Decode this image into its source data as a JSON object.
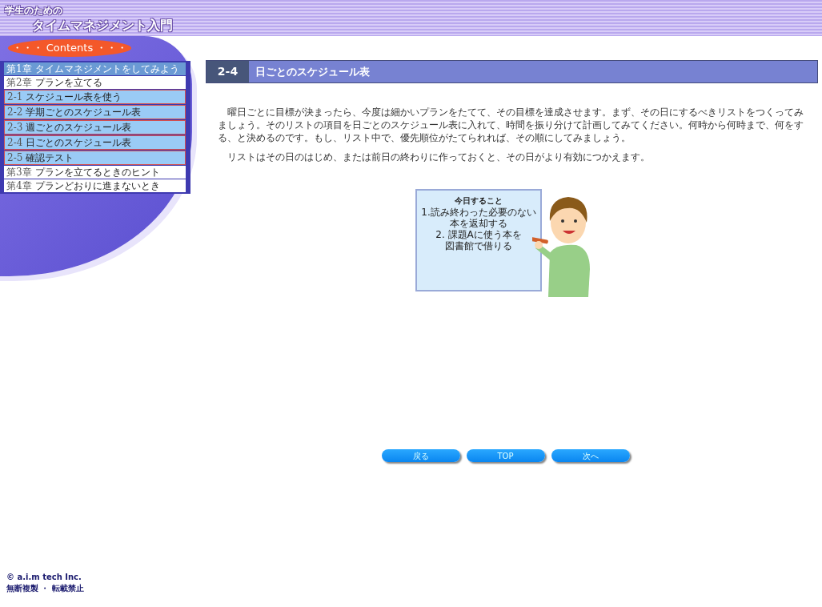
{
  "header": {
    "subtitle": "学生のための",
    "title": "タイムマネジメント入門",
    "contents_label": "・・・ Contents ・・・"
  },
  "menu": [
    {
      "kind": "chapter",
      "number": "第1章",
      "label": "タイムマネジメントをしてみよう",
      "selected": true
    },
    {
      "kind": "chapter",
      "number": "第2章",
      "label": "プランを立てる",
      "selected": false,
      "children": [
        {
          "kind": "section",
          "number": "2-1",
          "label": "スケジュール表を使う"
        },
        {
          "kind": "section",
          "number": "2-2",
          "label": "学期ごとのスケジュール表"
        },
        {
          "kind": "section",
          "number": "2-3",
          "label": "週ごとのスケジュール表"
        },
        {
          "kind": "section",
          "number": "2-4",
          "label": "日ごとのスケジュール表"
        },
        {
          "kind": "section",
          "number": "2-5",
          "label": "確認テスト"
        }
      ]
    },
    {
      "kind": "chapter",
      "number": "第3章",
      "label": "プランを立てるときのヒント",
      "selected": false
    },
    {
      "kind": "chapter",
      "number": "第4章",
      "label": "プランどおりに進まないとき",
      "selected": false
    }
  ],
  "page": {
    "number": "2-4",
    "title": "日ごとのスケジュール表",
    "paragraphs": [
      "曜日ごとに目標が決まったら、今度は細かいプランをたてて、その目標を達成させます。まず、その日にするべきリストをつくってみましょう。そのリストの項目を日ごとのスケジュール表に入れて、時間を振り分けて計画してみてください。何時から何時まで、何をする、と決めるのです。もし、リスト中で、優先順位がたてられれば、その順にしてみましょう。",
      "リストはその日のはじめ、または前日の終わりに作っておくと、その日がより有効につかえます。"
    ],
    "board": {
      "title": "今日すること",
      "lines": [
        "1.読み終わった必要のない",
        "本を返却する",
        "2. 課題Aに使う本を",
        "図書館で借りる"
      ]
    }
  },
  "nav_buttons": [
    "戻る",
    "TOP",
    "次へ"
  ],
  "footer": {
    "copyright": "© a.i.m tech Inc.",
    "notice": "無断複製 ・ 転載禁止"
  }
}
